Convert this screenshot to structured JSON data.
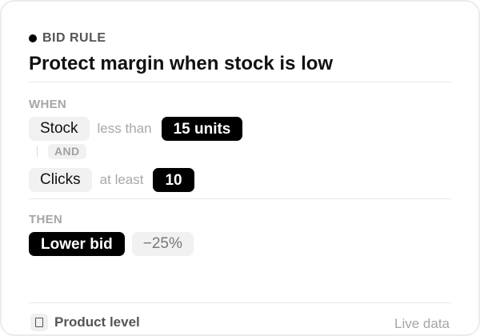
{
  "header": {
    "eyebrow": "BID RULE",
    "title": "Protect margin when stock is low"
  },
  "when": {
    "label": "WHEN",
    "conditions": [
      {
        "field": "Stock",
        "operator": "less than",
        "value": "15 units"
      },
      {
        "field": "Clicks",
        "operator": "at least",
        "value": "10"
      }
    ],
    "connector": "AND"
  },
  "then": {
    "label": "THEN",
    "action": "Lower bid",
    "amount": "−25%"
  },
  "footer": {
    "scope": "Product level",
    "status": "Live data",
    "scope_icon": "box-icon"
  },
  "colors": {
    "accent": "#000000",
    "muted_text": "#a6a6a6",
    "chip_bg": "#f1f1f1"
  }
}
